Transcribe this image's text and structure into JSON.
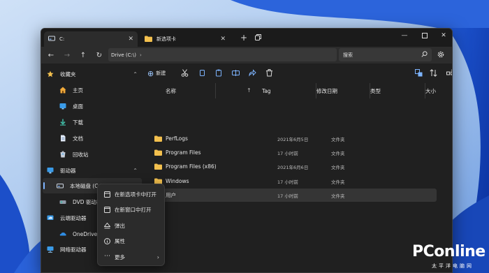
{
  "tabs": [
    {
      "label": "C:",
      "icon": "drive-icon",
      "active": true
    },
    {
      "label": "新选项卡",
      "icon": "folder-icon",
      "active": false
    }
  ],
  "address": {
    "path": "Drive (C:\\)"
  },
  "search": {
    "placeholder": "搜索"
  },
  "toolbar": {
    "new_label": "新建"
  },
  "sidebar": {
    "items": [
      {
        "label": "收藏夹",
        "icon": "star-icon"
      },
      {
        "label": "主页",
        "icon": "home-icon"
      },
      {
        "label": "桌面",
        "icon": "desktop-icon"
      },
      {
        "label": "下载",
        "icon": "download-icon"
      },
      {
        "label": "文档",
        "icon": "document-icon"
      },
      {
        "label": "回收站",
        "icon": "recycle-bin-icon"
      },
      {
        "label": "驱动器",
        "icon": "drives-icon"
      },
      {
        "label": "本地磁盘 (C:)",
        "icon": "drive-icon"
      },
      {
        "label": "DVD 驱动器",
        "icon": "dvd-icon"
      },
      {
        "label": "云端驱动器",
        "icon": "cloud-icon"
      },
      {
        "label": "OneDrive",
        "icon": "onedrive-icon"
      },
      {
        "label": "网络驱动器",
        "icon": "network-icon"
      }
    ]
  },
  "columns": [
    "名称",
    "Tag",
    "修改日期",
    "类型",
    "大小"
  ],
  "files": [
    {
      "name": "PerfLogs",
      "date": "2021年6月5日",
      "type": "文件夹"
    },
    {
      "name": "Program Files",
      "date": "17 小时前",
      "type": "文件夹"
    },
    {
      "name": "Program Files (x86)",
      "date": "2021年6月6日",
      "type": "文件夹"
    },
    {
      "name": "Windows",
      "date": "17 小时前",
      "type": "文件夹"
    },
    {
      "name": "用户",
      "date": "17 小时前",
      "type": "文件夹"
    }
  ],
  "context_menu": [
    {
      "label": "在新选项卡中打开",
      "icon": "open-tab-icon"
    },
    {
      "label": "在新窗口中打开",
      "icon": "open-window-icon"
    },
    {
      "label": "弹出",
      "icon": "eject-icon"
    },
    {
      "label": "属性",
      "icon": "info-icon"
    },
    {
      "label": "更多",
      "icon": "more-icon"
    }
  ],
  "watermark": {
    "main": "PConline",
    "sub": "太平洋电脑网"
  },
  "colors": {
    "accent": "#7db4ff",
    "folder": "#f3c04e",
    "window_bg": "#202020"
  }
}
